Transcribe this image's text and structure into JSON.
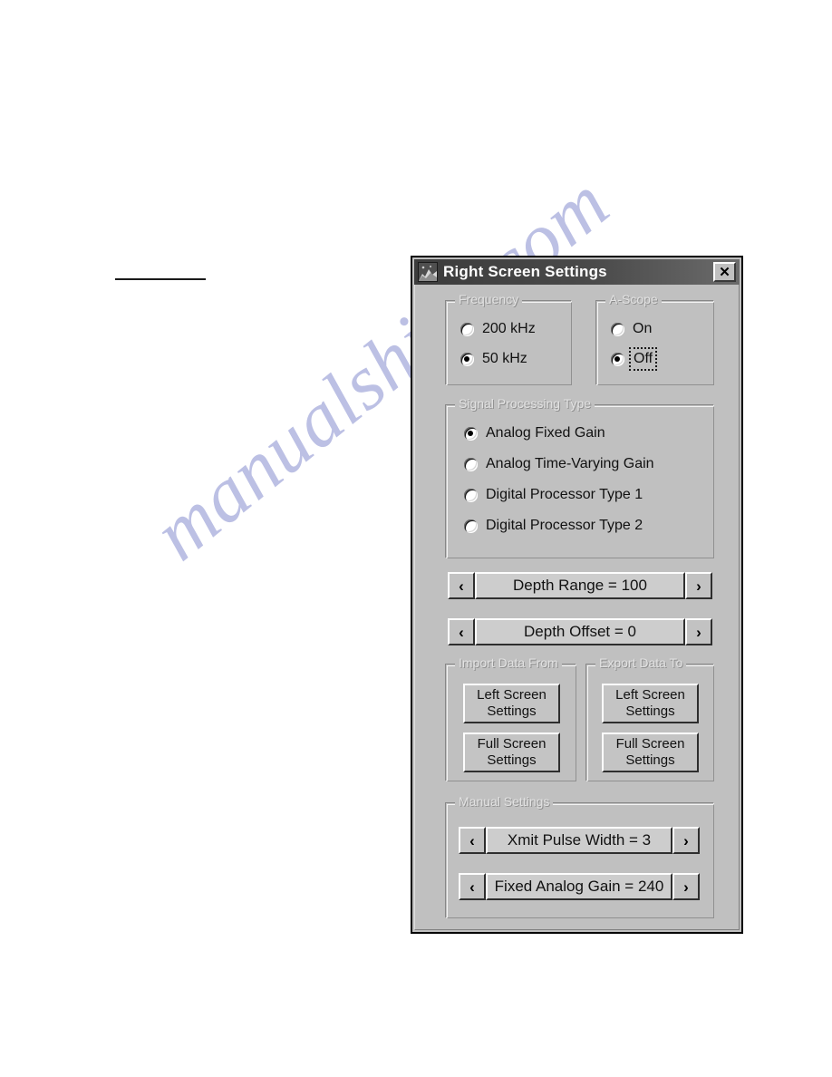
{
  "page": {
    "watermark_text": "manualshive.com",
    "watermark_color": "#bcc0e4"
  },
  "window": {
    "title": "Right Screen Settings",
    "icon": "terrain-sonar-icon",
    "close_label": "✕",
    "title_bar_color": "#4a4a4a",
    "face_color": "#c0c0c0"
  },
  "frequency_group": {
    "label": "Frequency",
    "options": [
      {
        "label": "200 kHz",
        "checked": false
      },
      {
        "label": "50 kHz",
        "checked": true
      }
    ]
  },
  "ascope_group": {
    "label": "A-Scope",
    "options": [
      {
        "label": "On",
        "checked": false,
        "focused": false
      },
      {
        "label": "Off",
        "checked": true,
        "focused": true
      }
    ]
  },
  "signal_processing_group": {
    "label": "Signal Processing Type",
    "options": [
      {
        "label": "Analog Fixed Gain",
        "checked": true
      },
      {
        "label": "Analog Time-Varying Gain",
        "checked": false
      },
      {
        "label": "Digital Processor Type 1",
        "checked": false
      },
      {
        "label": "Digital Processor Type 2",
        "checked": false
      }
    ]
  },
  "depth_spinners": [
    {
      "name": "depth-range",
      "text": "Depth Range = 100",
      "left_arrow": "‹",
      "right_arrow": "›"
    },
    {
      "name": "depth-offset",
      "text": "Depth Offset = 0",
      "left_arrow": "‹",
      "right_arrow": "›"
    }
  ],
  "import_group": {
    "label": "Import Data From",
    "buttons": [
      {
        "line1": "Left Screen",
        "line2": "Settings"
      },
      {
        "line1": "Full Screen",
        "line2": "Settings"
      }
    ]
  },
  "export_group": {
    "label": "Export Data To",
    "buttons": [
      {
        "line1": "Left Screen",
        "line2": "Settings"
      },
      {
        "line1": "Full Screen",
        "line2": "Settings"
      }
    ]
  },
  "manual_group": {
    "label": "Manual Settings",
    "spinners": [
      {
        "name": "xmit-pulse-width",
        "text": "Xmit Pulse Width = 3",
        "left_arrow": "‹",
        "right_arrow": "›"
      },
      {
        "name": "fixed-analog-gain",
        "text": "Fixed Analog Gain = 240",
        "left_arrow": "‹",
        "right_arrow": "›"
      }
    ]
  }
}
